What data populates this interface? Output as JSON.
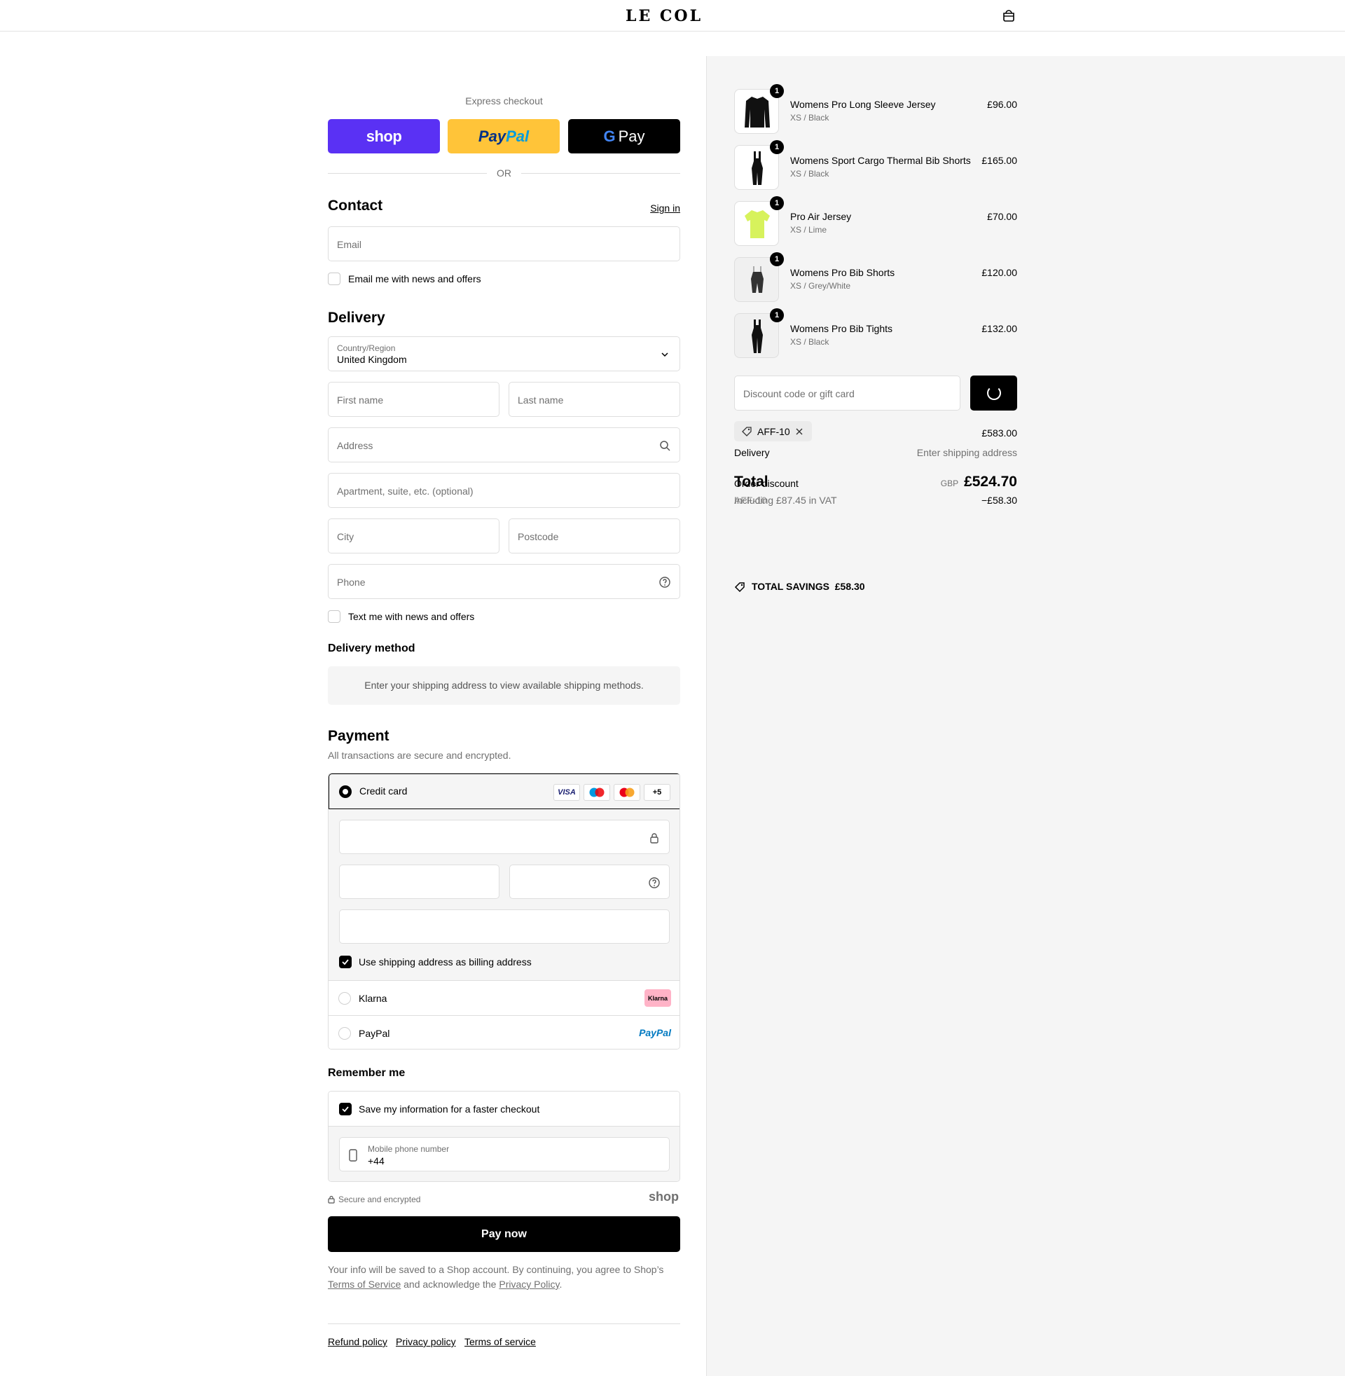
{
  "header": {
    "logo": "LE COL",
    "cart_icon": "bag-icon"
  },
  "express": {
    "title": "Express checkout",
    "shop_label": "shop",
    "paypal_label_a": "Pay",
    "paypal_label_b": "Pal",
    "gpay_g": "G",
    "gpay_label": "Pay",
    "or": "OR"
  },
  "contact": {
    "title": "Contact",
    "sign_in": "Sign in",
    "email_placeholder": "Email",
    "news_label": "Email me with news and offers"
  },
  "delivery": {
    "title": "Delivery",
    "country_label": "Country/Region",
    "country_value": "United Kingdom",
    "first_name": "First name",
    "last_name": "Last name",
    "address": "Address",
    "apartment": "Apartment, suite, etc. (optional)",
    "city": "City",
    "postcode": "Postcode",
    "phone": "Phone",
    "text_label": "Text me with news and offers",
    "method_title": "Delivery method",
    "method_notice": "Enter your shipping address to view available shipping methods."
  },
  "payment": {
    "title": "Payment",
    "subtitle": "All transactions are secure and encrypted.",
    "credit_card": "Credit card",
    "card_logos": [
      "VISA",
      "",
      "",
      "+5"
    ],
    "billing_label": "Use shipping address as billing address",
    "klarna": "Klarna",
    "klarna_badge": "Klarna",
    "paypal": "PayPal",
    "paypal_badge": "PayPal"
  },
  "remember": {
    "title": "Remember me",
    "save_label": "Save my information for a faster checkout",
    "phone_label": "Mobile phone number",
    "phone_value": "+44",
    "secure": "Secure and encrypted",
    "shop_brand": "shop"
  },
  "pay_now": "Pay now",
  "legal": {
    "text1": "Your info will be saved to a Shop account. By continuing, you agree to Shop’s",
    "tos": "Terms of Service",
    "text2": "and acknowledge the",
    "privacy": "Privacy Policy",
    "text3": "."
  },
  "footer": {
    "refund": "Refund policy",
    "privacy": "Privacy policy",
    "terms": "Terms of service"
  },
  "cart": {
    "items": [
      {
        "name": "Womens Pro Long Sleeve Jersey",
        "variant": "XS / Black",
        "price": "£96.00",
        "qty": "1",
        "color": "#111111"
      },
      {
        "name": "Womens Sport Cargo Thermal Bib Shorts",
        "variant": "XS / Black",
        "price": "£165.00",
        "qty": "1",
        "color": "#111111"
      },
      {
        "name": "Pro Air Jersey",
        "variant": "XS / Lime",
        "price": "£70.00",
        "qty": "1",
        "color": "#d7f25c"
      },
      {
        "name": "Womens Pro Bib Shorts",
        "variant": "XS / Grey/White",
        "price": "£120.00",
        "qty": "1",
        "color": "#333333"
      },
      {
        "name": "Womens Pro Bib Tights",
        "variant": "XS / Black",
        "price": "£132.00",
        "qty": "1",
        "color": "#111111"
      }
    ],
    "discount_placeholder": "Discount code or gift card",
    "tag_code": "AFF-10",
    "subtotal": "£583.00",
    "delivery_label": "Delivery",
    "delivery_value": "Enter shipping address",
    "total_label": "Total",
    "order_discount_label": "Order discount",
    "currency": "GBP",
    "total_value": "£524.70",
    "vat_note": "Including £87.45 in VAT",
    "discount_code_overlap": "AFF-10",
    "discount_value": "−£58.30",
    "savings": "TOTAL SAVINGS  £58.30"
  }
}
